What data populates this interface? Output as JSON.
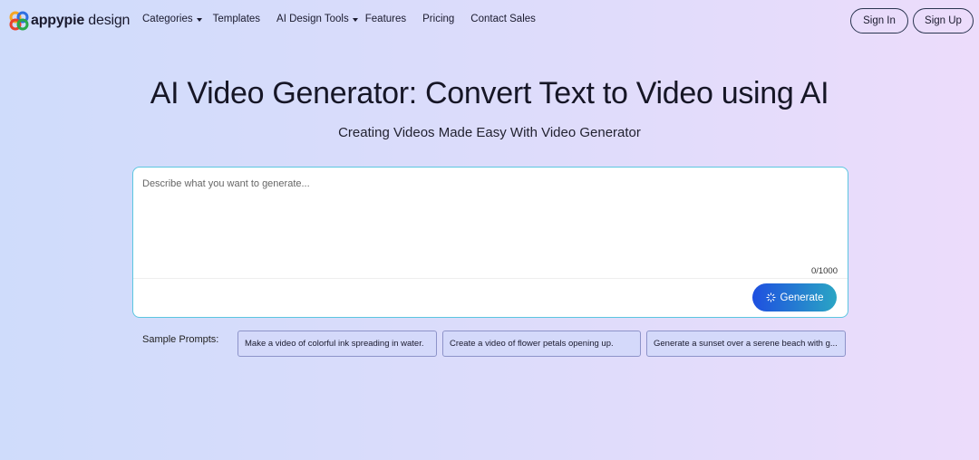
{
  "brand": {
    "name_bold": "appypie",
    "name_thin": " design",
    "logo_colors": [
      "#f5a623",
      "#e8412c",
      "#2aa84a",
      "#2e6fe0"
    ]
  },
  "nav": {
    "items": [
      {
        "label": "Categories",
        "has_dropdown": true
      },
      {
        "label": "Templates",
        "has_dropdown": false
      },
      {
        "label": "AI Design Tools",
        "has_dropdown": true
      },
      {
        "label": "Features",
        "has_dropdown": false
      },
      {
        "label": "Pricing",
        "has_dropdown": false
      },
      {
        "label": "Contact Sales",
        "has_dropdown": false
      }
    ],
    "sign_in": "Sign In",
    "sign_up": "Sign Up"
  },
  "hero": {
    "title": "AI Video Generator: Convert Text to Video using AI",
    "subtitle": "Creating Videos Made Easy With Video Generator"
  },
  "prompt": {
    "placeholder": "Describe what you want to generate...",
    "value": "",
    "counter": "0/1000",
    "generate_label": "Generate",
    "accent_start": "#1e4fe0",
    "accent_end": "#2aa5c4"
  },
  "samples": {
    "label": "Sample Prompts:",
    "items": [
      "Make a video of colorful ink spreading in water.",
      "Create a video of flower petals opening up.",
      "Generate a sunset over a serene beach with g..."
    ]
  }
}
